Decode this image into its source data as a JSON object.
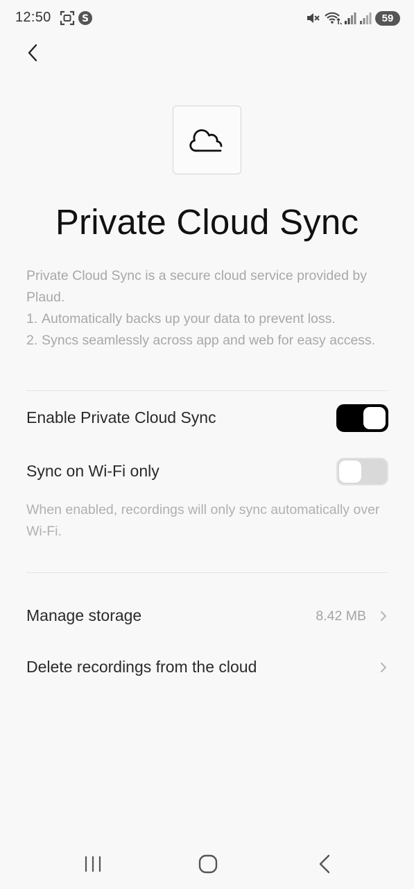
{
  "status_bar": {
    "time": "12:50",
    "battery_level": "59",
    "icons": [
      "screenshot-icon",
      "s-app-icon",
      "mute-icon",
      "wifi-icon",
      "signal-icon",
      "signal-icon-2"
    ]
  },
  "header": {
    "back_icon": "chevron-left-icon"
  },
  "hero": {
    "icon": "cloud-icon",
    "title": "Private Cloud Sync"
  },
  "intro": {
    "paragraph": "Private Cloud Sync is a secure cloud service provided by Plaud.",
    "items": [
      {
        "num": "1.",
        "text": "Automatically backs up your data to prevent loss."
      },
      {
        "num": "2.",
        "text": "Syncs seamlessly across app and web for easy access."
      }
    ]
  },
  "settings": {
    "enable_sync": {
      "label": "Enable Private Cloud Sync",
      "enabled": true
    },
    "wifi_only": {
      "label": "Sync on Wi-Fi only",
      "enabled": false
    },
    "wifi_note": "When enabled, recordings will only sync automatically over Wi-Fi."
  },
  "links": {
    "manage_storage": {
      "label": "Manage storage",
      "value": "8.42 MB"
    },
    "delete_recordings": {
      "label": "Delete recordings from the cloud"
    }
  },
  "colors": {
    "background": "#f8f8f8",
    "toggle_on": "#000000",
    "toggle_off": "#d9d9d9",
    "muted_text": "#a8a8a8"
  }
}
